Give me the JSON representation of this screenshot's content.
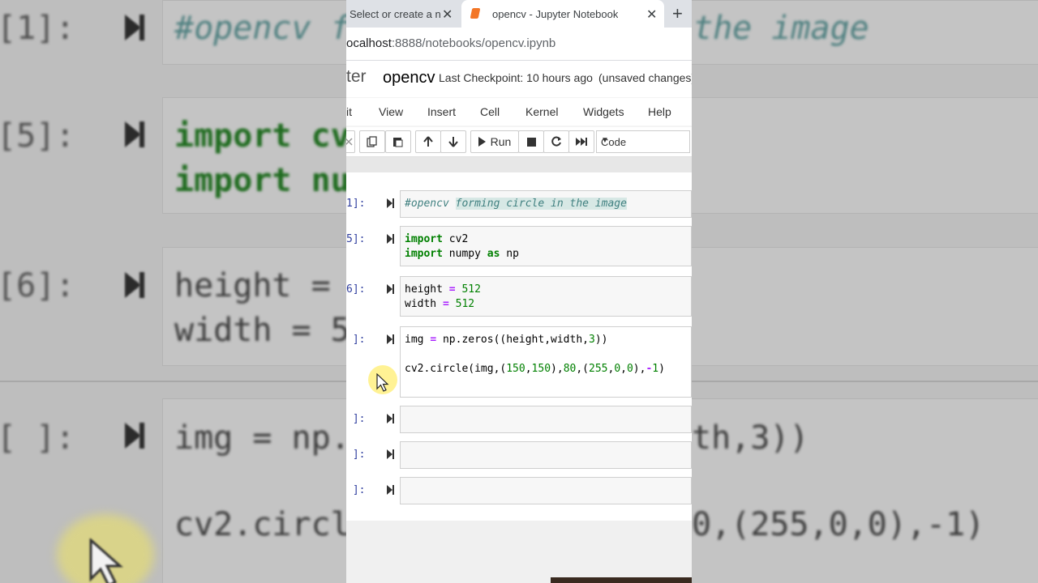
{
  "browser": {
    "tabs": [
      {
        "label": "Select or create a n",
        "active": false
      },
      {
        "label": "opencv - Jupyter Notebook",
        "active": true
      }
    ],
    "address": {
      "host": "ocalhost",
      "rest": ":8888/notebooks/opencv.ipynb"
    },
    "new_tab_icon": "plus-icon"
  },
  "header": {
    "logo_text": "ter",
    "notebook_name": "opencv",
    "checkpoint": "Last Checkpoint: 10 hours ago",
    "unsaved": "(unsaved changes)"
  },
  "menu": [
    "it",
    "View",
    "Insert",
    "Cell",
    "Kernel",
    "Widgets",
    "Help"
  ],
  "toolbar": {
    "run_label": "Run",
    "cell_type": "Code"
  },
  "cells": [
    {
      "prompt": "1]:"
    },
    {
      "prompt": "5]:"
    },
    {
      "prompt": "6]:"
    },
    {
      "prompt": " ]:"
    },
    {
      "prompt": " ]:"
    },
    {
      "prompt": " ]:"
    },
    {
      "prompt": " ]:"
    }
  ],
  "code": {
    "c1": {
      "comment1": "#opencv ",
      "comment2": "forming circle in the image"
    },
    "c2": {
      "l1_kw": "import",
      "l1": " cv2",
      "l2_kw": "import",
      "l2a": " numpy ",
      "l2_as": "as",
      "l2b": " np"
    },
    "c3": {
      "l1a": "height ",
      "eq": "=",
      "l1n": " 512",
      "l2a": "width ",
      "l2n": " 512"
    },
    "c4": {
      "l1a": "img ",
      "l1b": " np.zeros((height,width,",
      "l1n": "3",
      "l1c": "))",
      "l2a": "cv2.circle(img,(",
      "n150a": "150",
      "comma": ",",
      "n150b": "150",
      "l2b": "),",
      "n80": "80",
      "l2c": ",(",
      "n255": "255",
      "n0a": "0",
      "n0b": "0",
      "l2d": "),",
      "neg": "-",
      "n1": "1",
      "l2e": ")"
    }
  },
  "background": {
    "p1": "[1]:",
    "p5": "[5]:",
    "p6": "[6]:",
    "pe": "[ ]:",
    "comment": "#opencv f",
    "comment_tail": "the image",
    "imp1": "import cv",
    "imp2": "import nu",
    "h": "height = ",
    "w": "width = 5",
    "img": "img = np.",
    "img_tail": "th,3))",
    "circ": "cv2.circl",
    "circ_tail": "0,(255,0,0),-1)"
  }
}
